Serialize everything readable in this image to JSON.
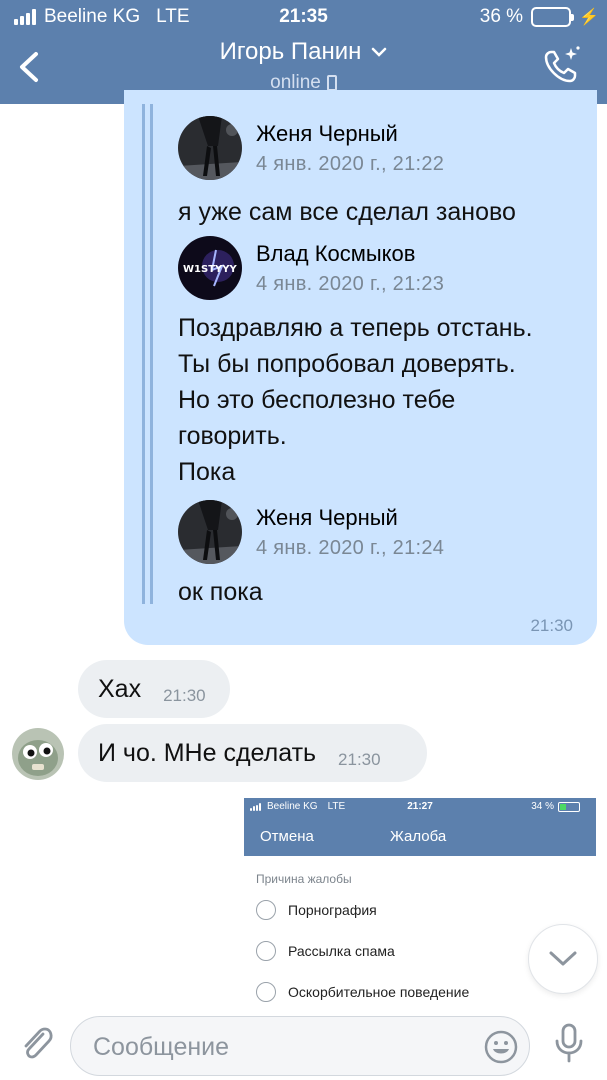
{
  "status_bar": {
    "carrier": "Beeline KG",
    "network": "LTE",
    "time": "21:35",
    "battery": "36 %"
  },
  "header": {
    "contact_name": "Игорь Панин",
    "presence": "online"
  },
  "outgoing_message": {
    "time": "21:30",
    "forwarded": [
      {
        "author": "Женя Черный",
        "date": "4 янв. 2020 г., 21:22",
        "lines": [
          "я уже сам все сделал заново"
        ]
      },
      {
        "author": "Влад Космыков",
        "date": "4 янв. 2020 г., 21:23",
        "avatar_text": "W1STYYY",
        "lines": [
          "Поздравляю а теперь отстань.",
          "Ты бы попробовал доверять.",
          "Но это бесполезно тебе",
          "говорить.",
          "Пока"
        ]
      },
      {
        "author": "Женя Черный",
        "date": "4 янв. 2020 г., 21:24",
        "lines": [
          "ок пока"
        ]
      }
    ]
  },
  "incoming_messages": [
    {
      "text": "Хах",
      "time": "21:30"
    },
    {
      "text": "И чо. МНе сделать",
      "time": "21:30"
    }
  ],
  "attached_screenshot": {
    "carrier": "Beeline KG",
    "network": "LTE",
    "time": "21:27",
    "battery": "34 %",
    "cancel_label": "Отмена",
    "title": "Жалоба",
    "section_label": "Причина жалобы",
    "options": [
      "Порнография",
      "Рассылка спама",
      "Оскорбительное поведение"
    ]
  },
  "composer": {
    "placeholder": "Сообщение"
  },
  "colors": {
    "header_bg": "#5c80ad",
    "outgoing_bubble": "#cce4ff",
    "incoming_bubble": "#eceff2"
  }
}
